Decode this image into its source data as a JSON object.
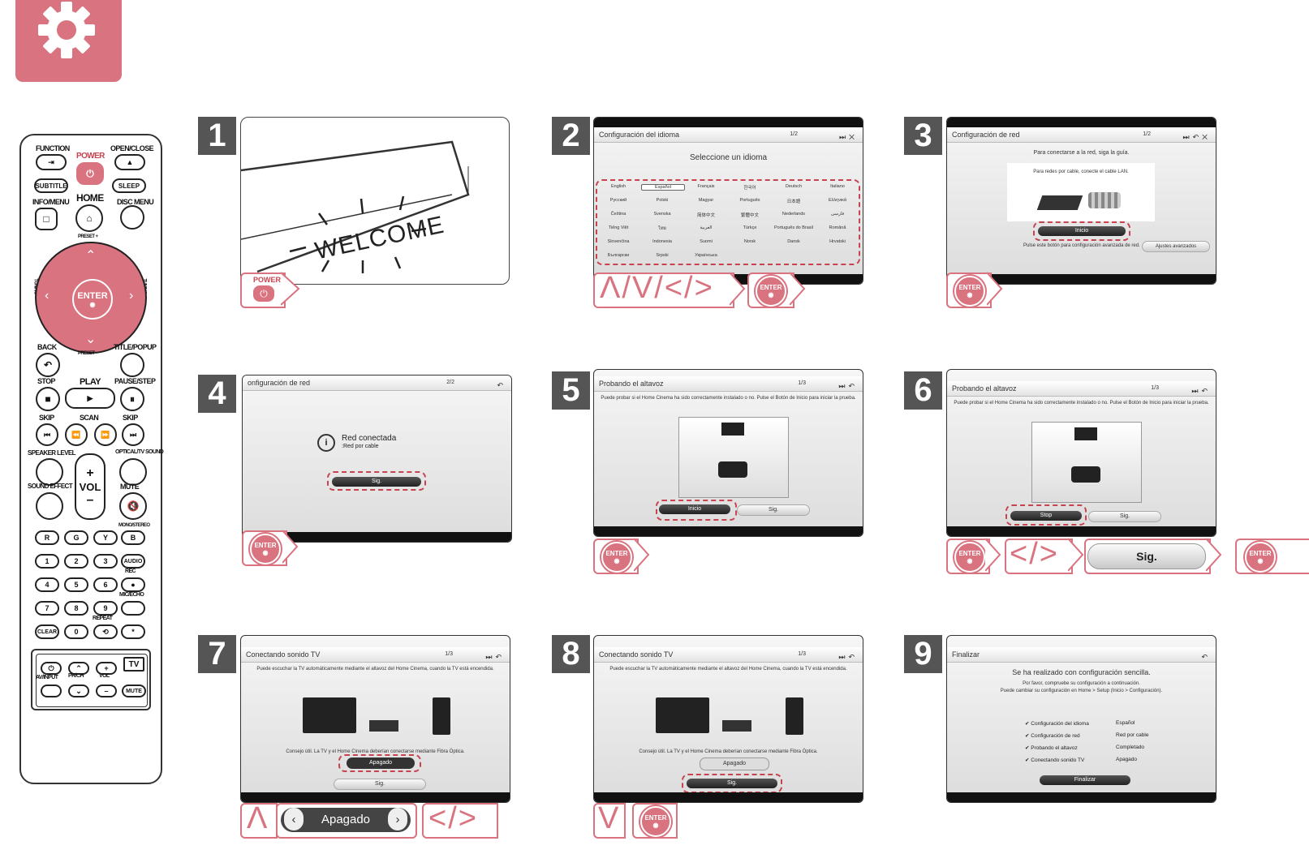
{
  "colors": {
    "accent": "#d9737f",
    "dashed": "#c7434f",
    "panel": "#555555"
  },
  "header": {
    "icon": "gear-icon"
  },
  "remote": {
    "function": "FUNCTION",
    "power": "POWER",
    "open_close": "OPEN/CLOSE",
    "subtitle": "SUBTITLE",
    "sleep": "SLEEP",
    "info_menu": "INFO/MENU",
    "home": "HOME",
    "disc_menu": "DISC MENU",
    "preset_plus": "PRESET +",
    "preset_minus": "PRESET –",
    "tuning_minus": "TUNING –",
    "tuning_plus": "TUNING +",
    "enter": "ENTER",
    "back": "BACK",
    "title_popup": "TITLE/POPUP",
    "stop": "STOP",
    "play": "PLAY",
    "pause_step": "PAUSE/STEP",
    "skip_left": "SKIP",
    "scan": "SCAN",
    "skip_right": "SKIP",
    "speaker_level": "SPEAKER LEVEL",
    "optical": "OPTICAL/TV SOUND",
    "sound_effect": "SOUND EFFECT",
    "vol": "VOL",
    "mute": "MUTE",
    "r": "R",
    "g": "G",
    "y": "Y",
    "b": "B",
    "mono": "MONO/STEREO",
    "n1": "1",
    "n2": "2",
    "n3": "3",
    "audio": "AUDIO",
    "n4": "4",
    "n5": "5",
    "n6": "6",
    "rec": "REC",
    "n7": "7",
    "n8": "8",
    "n9": "9",
    "mic": "MIC/ECHO",
    "clear": "CLEAR",
    "n0": "0",
    "repeat": "REPEAT",
    "star": "*",
    "tv": "TV",
    "av_input": "AV/INPUT",
    "pr_ch": "PR/CH",
    "tv_vol": "VOL",
    "tv_mute": "MUTE"
  },
  "steps": {
    "s1": {
      "num": "1",
      "welcome": "WELCOME",
      "power": "POWER"
    },
    "s2": {
      "num": "2",
      "title": "Configuración del idioma",
      "subtitle": "Seleccione un idioma",
      "page": "1/2",
      "langs": [
        "English",
        "Español",
        "Français",
        "한국어",
        "Deutsch",
        "Italiano",
        "Русский",
        "Polski",
        "Magyar",
        "Português",
        "日本語",
        "Ελληνικά",
        "Čeština",
        "Svenska",
        "简体中文",
        "繁體中文",
        "Nederlands",
        "فارسی",
        "Tiếng Việt",
        "ไทย",
        "العربية",
        "Türkçe",
        "Português do Brasil",
        "Română",
        "Slovenčina",
        "Indonesia",
        "Suomi",
        "Norsk",
        "Dansk",
        "Hrvatski",
        "Български",
        "Srpski",
        "Українська"
      ],
      "keys": "Λ/V/</>",
      "enter": "ENTER"
    },
    "s3": {
      "num": "3",
      "title": "Configuración de red",
      "page": "1/2",
      "line1": "Para conectarse a la red, siga la guía.",
      "line2": "Para redes por cable, conecte el cable LAN.",
      "start": "Inicio",
      "hint": "Pulse este botón para configuración avanzada de red.",
      "advanced": "Ajustes avanzados",
      "enter": "ENTER"
    },
    "s4": {
      "num": "4",
      "title": "onfiguración de red",
      "page": "2/2",
      "connected": "Red conectada",
      "type": ":Red por cable",
      "next": "Sig.",
      "enter": "ENTER"
    },
    "s5": {
      "num": "5",
      "title": "Probando el altavoz",
      "page": "1/3",
      "desc": "Puede probar si el Home Cinema ha sido correctamente instalado o no. Pulse el Botón de Inicio para iniciar la prueba.",
      "start": "Inicio",
      "next": "Sig.",
      "enter": "ENTER"
    },
    "s6": {
      "num": "6",
      "title": "Probando el altavoz",
      "page": "1/3",
      "desc": "Puede probar si el Home Cinema ha sido correctamente instalado o no. Pulse el Botón de Inicio para iniciar la prueba.",
      "stop": "Stop",
      "next": "Sig.",
      "keys": "</>",
      "big_next": "Sig.",
      "enter1": "ENTER",
      "enter2": "ENTER"
    },
    "s7": {
      "num": "7",
      "title": "Conectando sonido TV",
      "page": "1/3",
      "desc": "Puede escuchar la TV automáticamente mediante el altavoz del Home Cinema, cuando la TV está encendida.",
      "tip": "Consejo útil. La TV y el Home Cinema deberían conectarse mediante Fibra Óptica.",
      "value": "Apagado",
      "next": "Sig.",
      "key_up": "Λ",
      "big_value": "Apagado",
      "keys": "</>"
    },
    "s8": {
      "num": "8",
      "title": "Conectando sonido TV",
      "page": "1/3",
      "desc": "Puede escuchar la TV automáticamente mediante el altavoz del Home Cinema, cuando la TV está encendida.",
      "tip": "Consejo útil. La TV y el Home Cinema deberían conectarse mediante Fibra Óptica.",
      "value": "Apagado",
      "next": "Sig.",
      "key_down": "V",
      "enter": "ENTER"
    },
    "s9": {
      "num": "9",
      "title": "Finalizar",
      "heading": "Se ha realizado con configuración sencilla.",
      "line1": "Por favor, compruebe su configuración a continuación.",
      "line2": "Puede cambiar su configuración en Home > Setup (Inicio > Configuración).",
      "rows": [
        [
          "Configuración del idioma",
          "Español"
        ],
        [
          "Configuración de red",
          "Red por cable"
        ],
        [
          "Probando el altavoz",
          "Completado"
        ],
        [
          "Conectando sonido TV",
          "Apagado"
        ]
      ],
      "finish": "Finalizar"
    }
  }
}
